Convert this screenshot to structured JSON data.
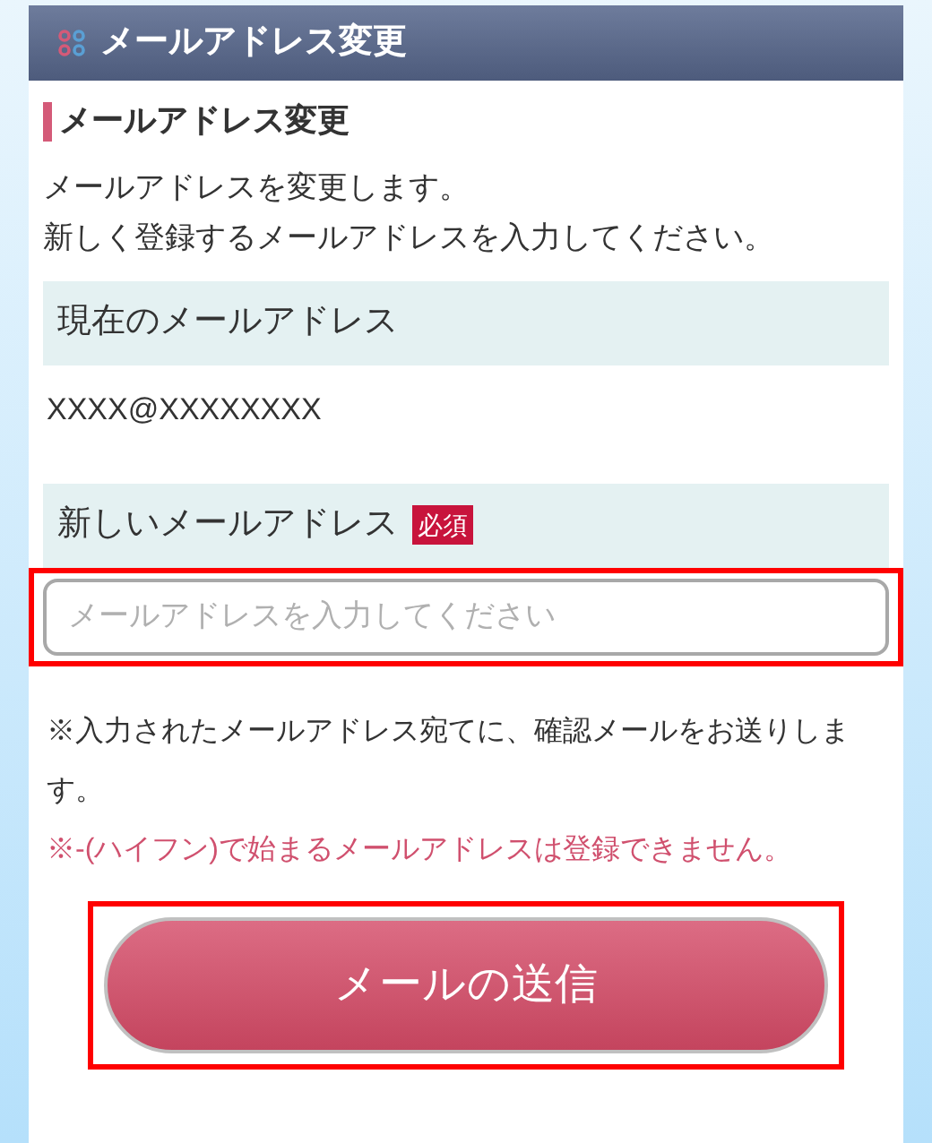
{
  "header": {
    "title": "メールアドレス変更"
  },
  "section_title": "メールアドレス変更",
  "intro": [
    "メールアドレスを変更します。",
    "新しく登録するメールアドレスを入力してください。"
  ],
  "current": {
    "label": "現在のメールアドレス",
    "value": "XXXX@XXXXXXXX"
  },
  "new": {
    "label": "新しいメールアドレス",
    "badge": "必須",
    "placeholder": "メールアドレスを入力してください",
    "highlighted": true
  },
  "notes": [
    {
      "kind": "info",
      "text": "※入力されたメールアドレス宛てに、確認メールをお送りします。"
    },
    {
      "kind": "warning",
      "text": "※-(ハイフン)で始まるメールアドレスは登録できません。"
    }
  ],
  "submit": {
    "label": "メールの送信",
    "highlighted": true
  }
}
